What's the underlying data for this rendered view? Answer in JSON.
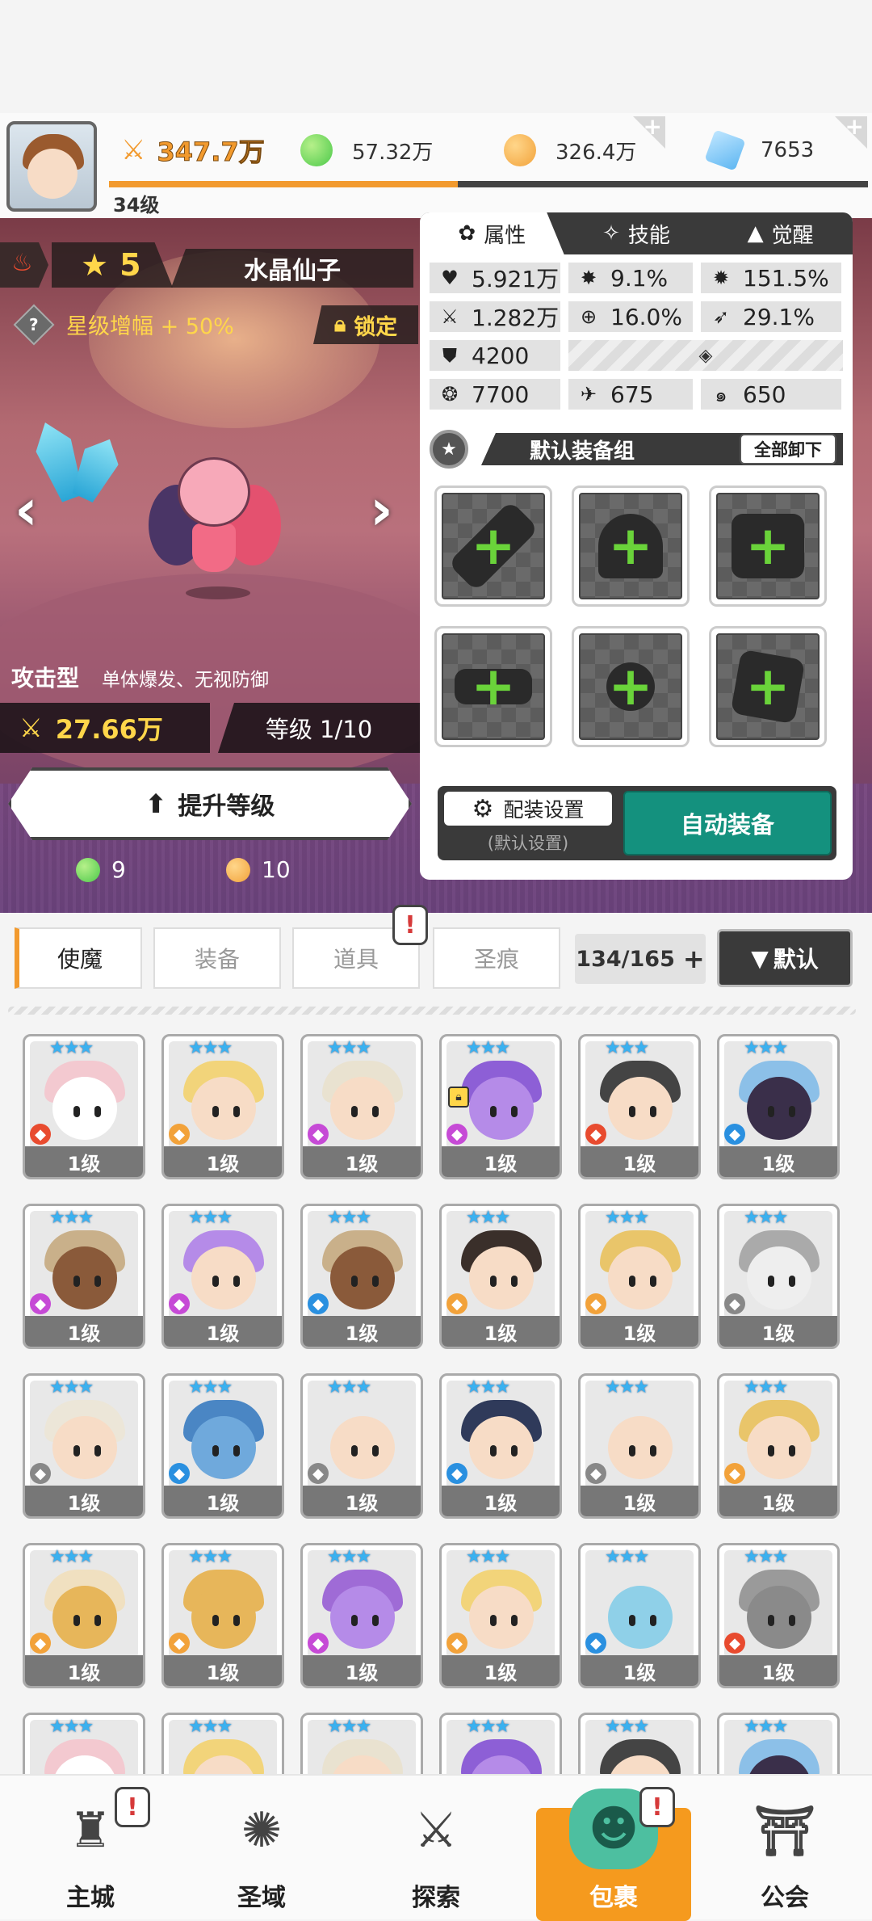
{
  "header": {
    "player_level": "34级",
    "power": "347.7万",
    "currencies": [
      {
        "icon": "green-orb-icon",
        "value": "57.32万",
        "color": "#4cc94a"
      },
      {
        "icon": "gold-coin-icon",
        "value": "326.4万",
        "color": "#f2a23a"
      },
      {
        "icon": "blue-crystal-icon",
        "value": "7653",
        "color": "#5fb7f2"
      }
    ]
  },
  "hero": {
    "stars": "5",
    "name": "水晶仙子",
    "star_boost": "星级增幅 + 50%",
    "lock_label": "锁定",
    "type": "攻击型",
    "traits": "单体爆发、无视防御",
    "power": "27.66万",
    "level": "等级 1/10",
    "upgrade_label": "提升等级",
    "cost_green": "9",
    "cost_gold": "10"
  },
  "detail": {
    "tabs": [
      "属性",
      "技能",
      "觉醒"
    ],
    "stats": {
      "hp": "5.921万",
      "crit": "9.1%",
      "crit_dmg": "151.5%",
      "atk": "1.282万",
      "accuracy": "16.0%",
      "speed": "29.1%",
      "defense": "4200",
      "stat_a": "7700",
      "stat_b": "675",
      "stat_c": "650"
    },
    "equip_group": "默认装备组",
    "unload_all": "全部卸下",
    "loadout_settings": "配装设置",
    "loadout_default": "(默认设置)",
    "auto_equip": "自动装备"
  },
  "bag": {
    "tabs": [
      "使魔",
      "装备",
      "道具",
      "圣痕"
    ],
    "count": "134/165",
    "sort_label": "默认",
    "card_level": "1级"
  },
  "bottom_nav": [
    "主城",
    "圣域",
    "探索",
    "包裹",
    "公会"
  ],
  "colors": {
    "accent": "#f29a2e",
    "auto_equip": "#14917e",
    "nav_active": "#f59a1e"
  }
}
